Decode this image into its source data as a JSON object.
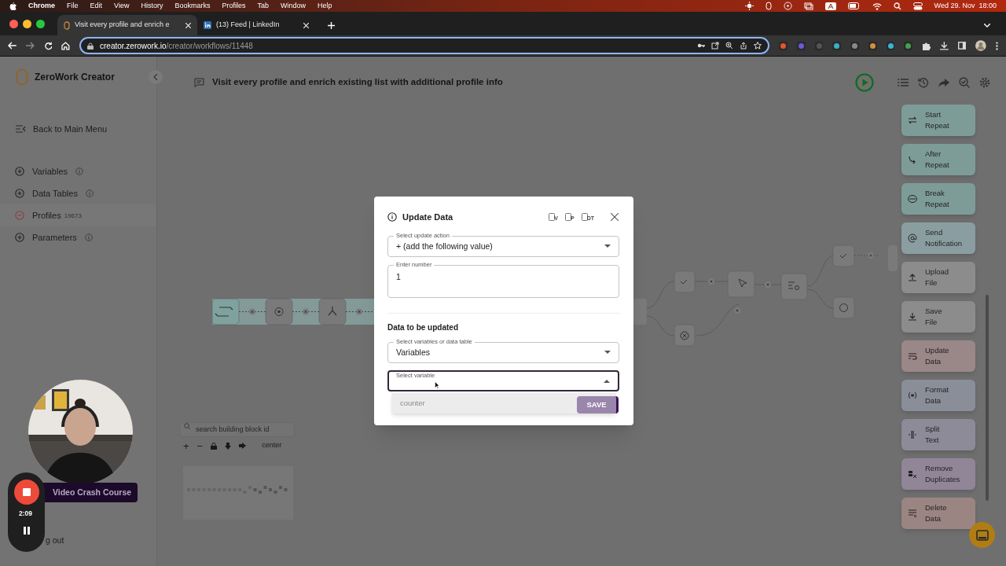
{
  "menubar": {
    "app": "Chrome",
    "items": [
      "File",
      "Edit",
      "View",
      "History",
      "Bookmarks",
      "Profiles",
      "Tab",
      "Window",
      "Help"
    ],
    "clock": "Wed 29. Nov  18:00"
  },
  "browser_tabs": [
    {
      "title": "Visit every profile and enrich e",
      "selected": true
    },
    {
      "title": "(13) Feed | LinkedIn",
      "selected": false
    }
  ],
  "address": {
    "host": "creator.zerowork.io",
    "path": "/creator/workflows/11448"
  },
  "sidebar": {
    "brand": "ZeroWork Creator",
    "back": "Back to Main Menu",
    "sections": [
      {
        "label": "Variables",
        "expanded": false
      },
      {
        "label": "Data Tables",
        "expanded": false
      },
      {
        "label": "Profiles",
        "expanded": true,
        "count": "19673"
      },
      {
        "label": "Parameters",
        "expanded": false
      }
    ],
    "course_button": "Video Crash Course",
    "logout": "g out"
  },
  "recorder": {
    "time": "2:09"
  },
  "workflow_title": "Visit every profile and enrich existing list with additional profile info",
  "canvas": {
    "search_placeholder": "search building block id",
    "zoom_in": "+",
    "zoom_out": "−",
    "center": "center"
  },
  "blocks": [
    {
      "label": "Start\nRepeat",
      "color": "#7e9c97"
    },
    {
      "label": "After\nRepeat",
      "color": "#7e9c97"
    },
    {
      "label": "Break\nRepeat",
      "color": "#7e9c97"
    },
    {
      "label": "Send\nNotification",
      "color": "#8a9ea1"
    },
    {
      "label": "Upload\nFile",
      "color": "#8c8c8c"
    },
    {
      "label": "Save\nFile",
      "color": "#8c8c8c"
    },
    {
      "label": "Update\nData",
      "color": "#9a8788"
    },
    {
      "label": "Format\nData",
      "color": "#8a8e98"
    },
    {
      "label": "Split\nText",
      "color": "#8d8b98"
    },
    {
      "label": "Remove\nDuplicates",
      "color": "#908698"
    },
    {
      "label": "Delete\nData",
      "color": "#9b8582"
    }
  ],
  "dialog": {
    "title": "Update Data",
    "tags": [
      "V",
      "P",
      "DT"
    ],
    "fields": [
      {
        "kind": "select",
        "label": "Select update action",
        "value": "+ (add the following value)"
      },
      {
        "kind": "textarea",
        "label": "Enter number",
        "value": "1"
      }
    ],
    "section": "Data to be updated",
    "target_fields": [
      {
        "kind": "select",
        "label": "Select variables or data table",
        "value": "Variables",
        "expanded": false
      },
      {
        "kind": "select",
        "label": "Select variable",
        "expanded": true
      }
    ],
    "options": [
      "counter"
    ],
    "save": "SAVE"
  }
}
